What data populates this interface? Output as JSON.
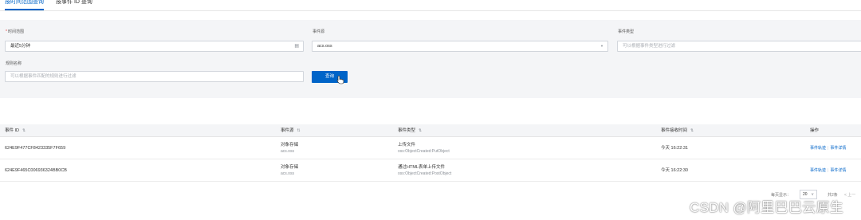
{
  "tabs": [
    {
      "label": "按时间范围查询",
      "active": true
    },
    {
      "label": "按事件 ID 查询",
      "active": false
    }
  ],
  "filters": {
    "time_range": {
      "required_mark": "*",
      "label": "时间范围",
      "value": "最近5分钟",
      "icon": "calendar-icon"
    },
    "event_source": {
      "label": "事件源",
      "value": "acs.oss",
      "icon": "caret-down-icon"
    },
    "event_type": {
      "label": "事件类型",
      "placeholder": "可以根据事件类型进行过滤"
    },
    "rule_name": {
      "label": "规则名称",
      "placeholder": "可以根据事件匹配的规则进行过滤"
    },
    "query_button": "查询"
  },
  "table": {
    "columns": [
      {
        "label": "事件 ID",
        "sortable": true
      },
      {
        "label": "事件源",
        "sortable": true
      },
      {
        "label": "事件类型",
        "sortable": true
      },
      {
        "label": "事件接收时间",
        "sortable": true
      },
      {
        "label": "操作",
        "sortable": false
      }
    ],
    "sort_icon": "⇅",
    "rows": [
      {
        "event_id": "624E9F477CF8423335F7F659",
        "source_name": "对象存储",
        "source_code": "acs.oss",
        "type_name": "上传文件",
        "type_code": "oss:ObjectCreated:PutObject",
        "received": "今天 16:22:31",
        "action_trace": "事件轨迹",
        "action_detail": "事件详情"
      },
      {
        "event_id": "624E9F465C006936324BB0CB",
        "source_name": "对象存储",
        "source_code": "acs.oss",
        "type_name": "通过HTML表单上传文件",
        "type_code": "oss:ObjectCreated:PostObject",
        "received": "今天 16:22:30",
        "action_trace": "事件轨迹",
        "action_detail": "事件详情"
      }
    ]
  },
  "pagination": {
    "per_page_label": "每页显示：",
    "per_page_value": "20",
    "total_label": "共2条",
    "prev_label": "< 上一"
  },
  "watermark": "CSDN @阿里巴巴云原生",
  "colors": {
    "accent": "#0064c8",
    "panel_bg": "#f4f5f7",
    "required": "#e62e2e"
  }
}
